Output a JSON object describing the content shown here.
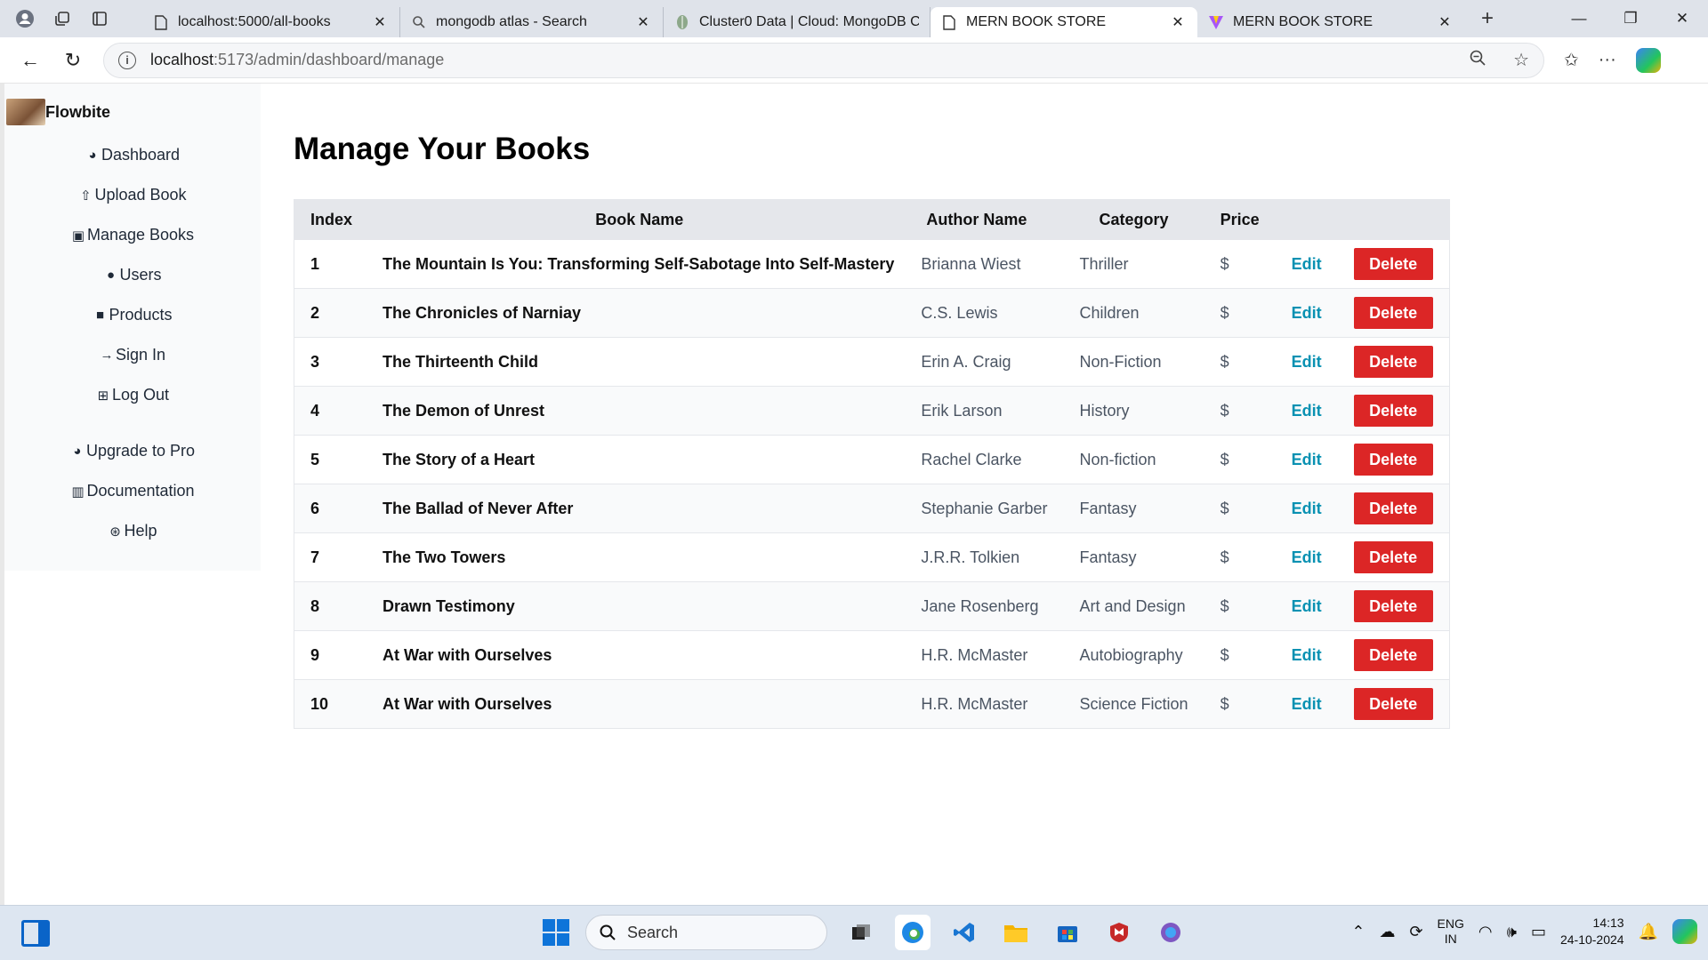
{
  "browser": {
    "tabs": [
      {
        "title": "localhost:5000/all-books",
        "active": false,
        "icon": "page-icon"
      },
      {
        "title": "mongodb atlas - Search",
        "active": false,
        "icon": "search-icon"
      },
      {
        "title": "Cluster0 Data | Cloud: MongoDB C",
        "active": false,
        "icon": "mongodb-leaf-icon"
      },
      {
        "title": "MERN BOOK STORE",
        "active": true,
        "icon": "page-icon"
      },
      {
        "title": "MERN BOOK STORE",
        "active": false,
        "icon": "vite-icon"
      }
    ],
    "url_host": "localhost",
    "url_path": ":5173/admin/dashboard/manage"
  },
  "sidebar": {
    "brand": "Flowbite",
    "items": [
      {
        "label": "Dashboard",
        "icon": "pie-chart-icon"
      },
      {
        "label": "Upload Book",
        "icon": "cloud-upload-icon"
      },
      {
        "label": "Manage Books",
        "icon": "inbox-icon"
      },
      {
        "label": "Users",
        "icon": "user-icon"
      },
      {
        "label": "Products",
        "icon": "shopping-bag-icon"
      },
      {
        "label": "Sign In",
        "icon": "arrow-right-icon"
      },
      {
        "label": "Log Out",
        "icon": "table-icon"
      }
    ],
    "secondary": [
      {
        "label": "Upgrade to Pro",
        "icon": "pie-chart-icon"
      },
      {
        "label": "Documentation",
        "icon": "view-boards-icon"
      },
      {
        "label": "Help",
        "icon": "support-icon"
      }
    ]
  },
  "main": {
    "title": "Manage Your Books",
    "columns": {
      "index": "Index",
      "book": "Book Name",
      "author": "Author Name",
      "category": "Category",
      "price": "Price"
    },
    "edit_label": "Edit",
    "delete_label": "Delete",
    "rows": [
      {
        "index": "1",
        "book": "The Mountain Is You: Transforming Self-Sabotage Into Self-Mastery",
        "author": "Brianna Wiest",
        "category": "Thriller",
        "price": "$"
      },
      {
        "index": "2",
        "book": "The Chronicles of Narniay",
        "author": "C.S. Lewis",
        "category": "Children",
        "price": "$"
      },
      {
        "index": "3",
        "book": "The Thirteenth Child",
        "author": "Erin A. Craig",
        "category": "Non-Fiction",
        "price": "$"
      },
      {
        "index": "4",
        "book": "The Demon of Unrest",
        "author": "Erik Larson",
        "category": "History",
        "price": "$"
      },
      {
        "index": "5",
        "book": "The Story of a Heart",
        "author": "Rachel Clarke",
        "category": "Non-fiction",
        "price": "$"
      },
      {
        "index": "6",
        "book": "The Ballad of Never After",
        "author": "Stephanie Garber",
        "category": "Fantasy",
        "price": "$"
      },
      {
        "index": "7",
        "book": "The Two Towers",
        "author": "J.R.R. Tolkien",
        "category": "Fantasy",
        "price": "$"
      },
      {
        "index": "8",
        "book": "Drawn Testimony",
        "author": "Jane Rosenberg",
        "category": "Art and Design",
        "price": "$"
      },
      {
        "index": "9",
        "book": "At War with Ourselves",
        "author": "H.R. McMaster",
        "category": "Autobiography",
        "price": "$"
      },
      {
        "index": "10",
        "book": "At War with Ourselves",
        "author": "H.R. McMaster",
        "category": "Science Fiction",
        "price": "$"
      }
    ]
  },
  "taskbar": {
    "search_placeholder": "Search",
    "lang_line1": "ENG",
    "lang_line2": "IN",
    "time": "14:13",
    "date": "24-10-2024"
  },
  "colors": {
    "delete": "#dc2626",
    "edit": "#0891b2",
    "table_header": "#e5e7eb",
    "sidebar_bg": "#f9fafb"
  }
}
